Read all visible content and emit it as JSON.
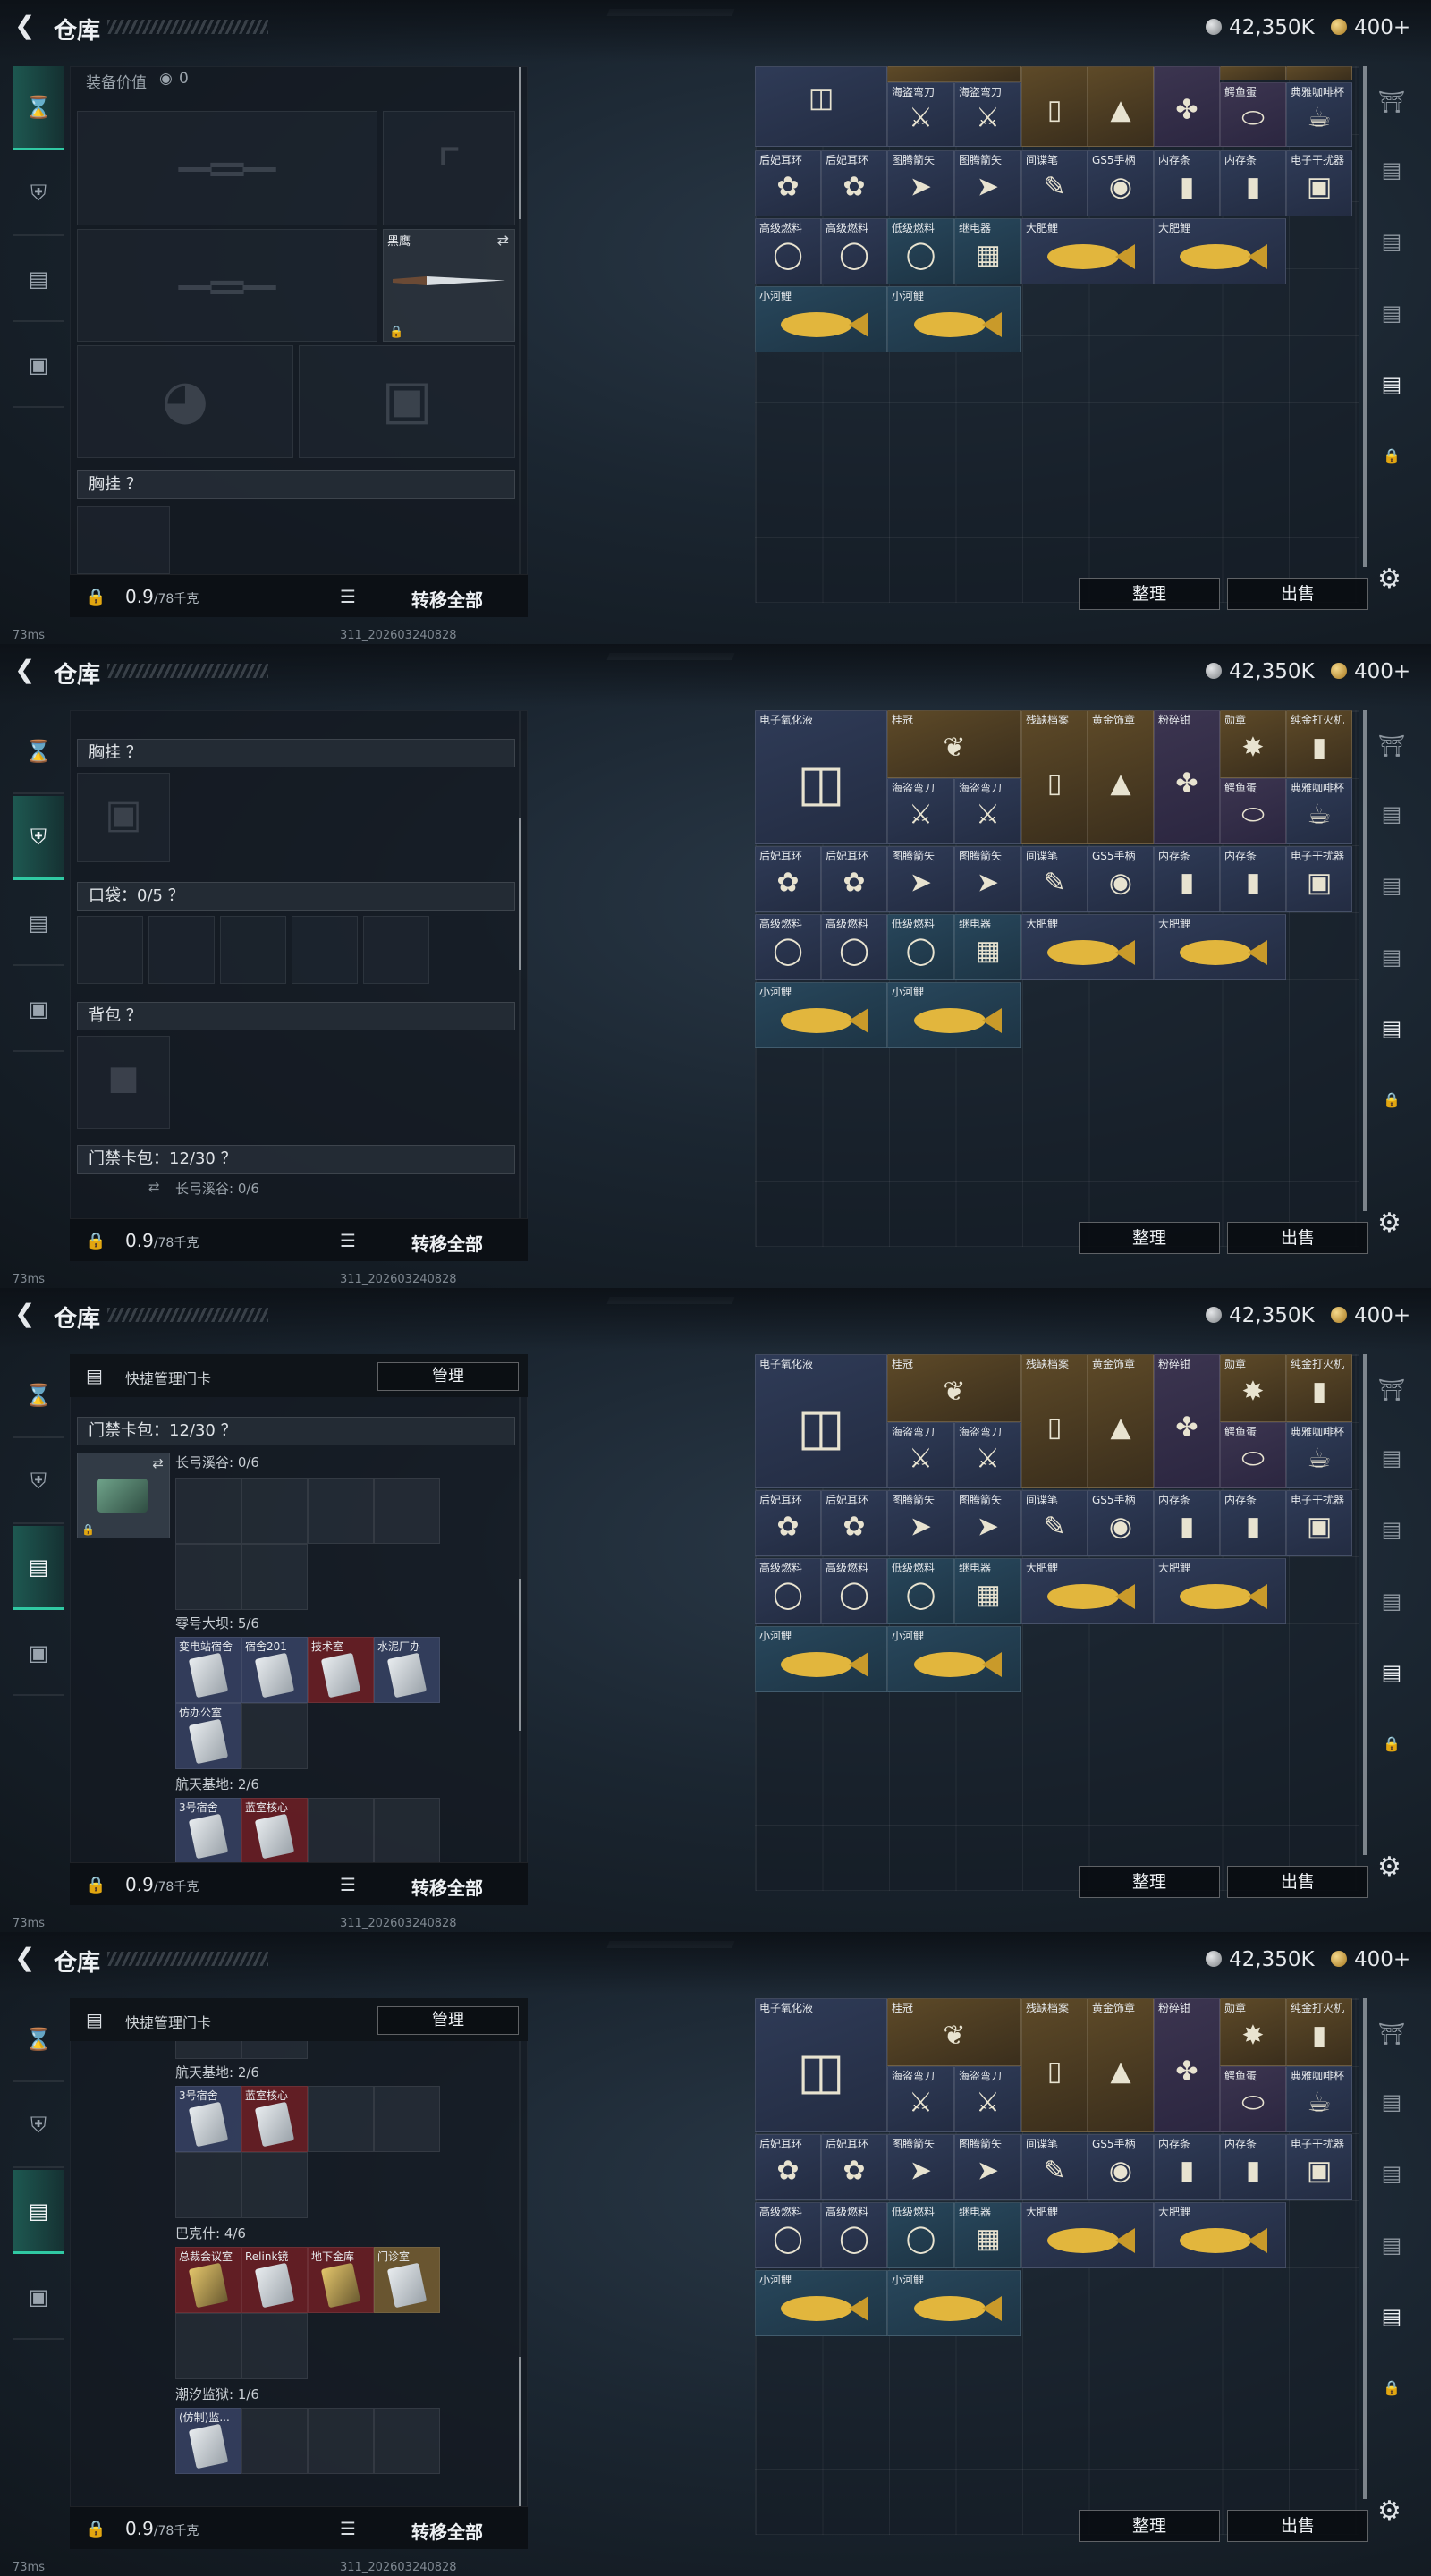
{
  "app": {
    "title": "仓库",
    "silver": "42,350K",
    "gold": "400+",
    "ping": "73ms",
    "build": "311_202603240828"
  },
  "bottom": {
    "weight": "0.9",
    "weight_max": "/78千克",
    "transfer_all": "转移全部"
  },
  "right_buttons": {
    "sort": "整理",
    "sell": "出售"
  },
  "panel1": {
    "equip_value_label": "装备价值",
    "equip_value": "0",
    "knife_label": "黑鹰",
    "vest_label": "胸挂 ？"
  },
  "panel2": {
    "vest_label": "胸挂 ？",
    "pocket_label": "口袋：0/5 ？",
    "backpack_label": "背包 ？",
    "keycard_bag_label": "门禁卡包：12/30 ？",
    "zone_label": "长弓溪谷: 0/6"
  },
  "panel3": {
    "quick_manage": "快捷管理门卡",
    "manage_button": "管理",
    "keycard_bag_label": "门禁卡包：12/30 ？",
    "zone1_label": "长弓溪谷: 0/6",
    "zone2_label": "零号大坝: 5/6",
    "zone2_cards": [
      "变电站宿舍",
      "宿舍201",
      "技术室",
      "水泥厂办",
      "仿办公室"
    ],
    "zone3_label": "航天基地: 2/6",
    "zone3_cards": [
      "3号宿舍",
      "蓝室核心"
    ]
  },
  "panel4": {
    "quick_manage": "快捷管理门卡",
    "manage_button": "管理",
    "zone3_label": "航天基地: 2/6",
    "zone3_cards": [
      "3号宿舍",
      "蓝室核心"
    ],
    "zone4_label": "巴克什: 4/6",
    "zone4_cards": [
      "总裁会议室",
      "Relink镜",
      "地下金库",
      "门诊室"
    ],
    "zone5_label": "潮汐监狱: 1/6",
    "zone5_cards": [
      "(仿制)监..."
    ]
  },
  "inventory": {
    "row0": [
      "电子氧化液",
      "桂冠",
      "残缺档案",
      "黄金饰章",
      "粉碎钳",
      "勋章",
      "纯金打火机"
    ],
    "row1": [
      "海盗弯刀",
      "海盗弯刀",
      "鳄鱼蛋",
      "典雅咖啡杯"
    ],
    "row2": [
      "后妃耳环",
      "后妃耳环",
      "图腾箭矢",
      "图腾箭矢",
      "间谍笔",
      "GS5手柄",
      "内存条",
      "内存条",
      "电子干扰器"
    ],
    "row3": [
      "高级燃料",
      "高级燃料",
      "低级燃料",
      "继电器",
      "大肥鲤",
      "大肥鲤"
    ],
    "row4": [
      "小河鲤",
      "小河鲤"
    ]
  }
}
